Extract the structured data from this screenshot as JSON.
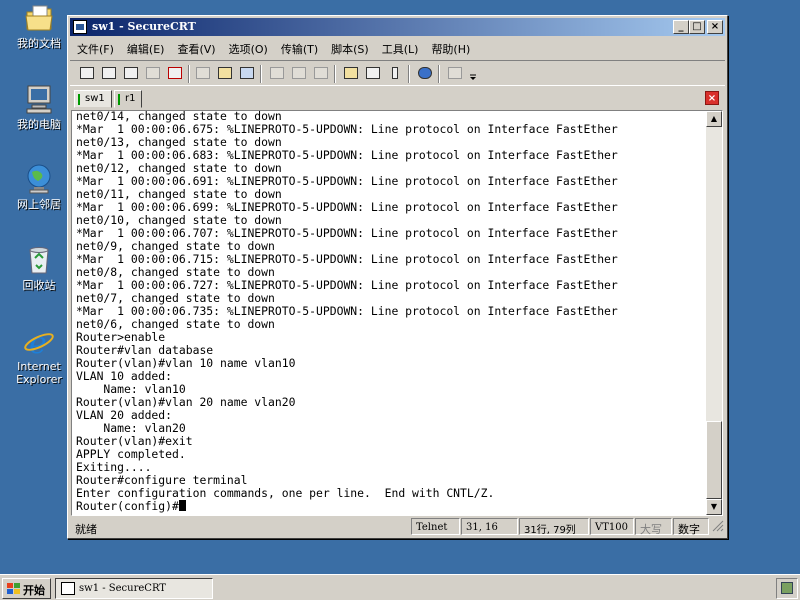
{
  "desktop": {
    "icons": [
      {
        "label": "我的文档",
        "icon": "folder-icon"
      },
      {
        "label": "我的电脑",
        "icon": "computer-icon"
      },
      {
        "label": "网上邻居",
        "icon": "network-icon"
      },
      {
        "label": "回收站",
        "icon": "recycle-bin-icon"
      },
      {
        "label": "Internet Explorer",
        "icon": "ie-icon"
      }
    ]
  },
  "window": {
    "title": "sw1 - SecureCRT",
    "minimize": "_",
    "maximize": "□",
    "close": "×"
  },
  "menu": [
    "文件(F)",
    "编辑(E)",
    "查看(V)",
    "选项(O)",
    "传输(T)",
    "脚本(S)",
    "工具(L)",
    "帮助(H)"
  ],
  "toolbar": {
    "buttons": [
      "connect-icon",
      "quick-connect-icon",
      "connect-in-tab-icon",
      "reconnect-icon",
      "disconnect-icon",
      "copy-icon",
      "paste-icon",
      "find-icon",
      "print-icon",
      "print-selection-icon",
      "print-setup-icon",
      "session-options-icon",
      "global-options-icon",
      "keymap-icon",
      "help-icon",
      "sftp-icon"
    ]
  },
  "tabs": [
    {
      "label": "sw1",
      "active": true
    },
    {
      "label": "r1",
      "active": false
    }
  ],
  "terminal": {
    "lines": [
      "net0/14, changed state to down",
      "*Mar  1 00:00:06.675: %LINEPROTO-5-UPDOWN: Line protocol on Interface FastEther",
      "net0/13, changed state to down",
      "*Mar  1 00:00:06.683: %LINEPROTO-5-UPDOWN: Line protocol on Interface FastEther",
      "net0/12, changed state to down",
      "*Mar  1 00:00:06.691: %LINEPROTO-5-UPDOWN: Line protocol on Interface FastEther",
      "net0/11, changed state to down",
      "*Mar  1 00:00:06.699: %LINEPROTO-5-UPDOWN: Line protocol on Interface FastEther",
      "net0/10, changed state to down",
      "*Mar  1 00:00:06.707: %LINEPROTO-5-UPDOWN: Line protocol on Interface FastEther",
      "net0/9, changed state to down",
      "*Mar  1 00:00:06.715: %LINEPROTO-5-UPDOWN: Line protocol on Interface FastEther",
      "net0/8, changed state to down",
      "*Mar  1 00:00:06.727: %LINEPROTO-5-UPDOWN: Line protocol on Interface FastEther",
      "net0/7, changed state to down",
      "*Mar  1 00:00:06.735: %LINEPROTO-5-UPDOWN: Line protocol on Interface FastEther",
      "net0/6, changed state to down",
      "Router>enable",
      "Router#vlan database",
      "Router(vlan)#vlan 10 name vlan10",
      "VLAN 10 added:",
      "    Name: vlan10",
      "Router(vlan)#vlan 20 name vlan20",
      "VLAN 20 added:",
      "    Name: vlan20",
      "Router(vlan)#exit",
      "APPLY completed.",
      "Exiting....",
      "Router#configure terminal",
      "Enter configuration commands, one per line.  End with CNTL/Z.",
      "Router(config)#"
    ]
  },
  "status": {
    "ready": "就绪",
    "protocol": "Telnet",
    "cursor_pos": "31,  16",
    "size": "31行, 79列",
    "emulation": "VT100",
    "caps": "大写",
    "num": "数字"
  },
  "taskbar": {
    "start": "开始",
    "item": "sw1 - SecureCRT"
  }
}
